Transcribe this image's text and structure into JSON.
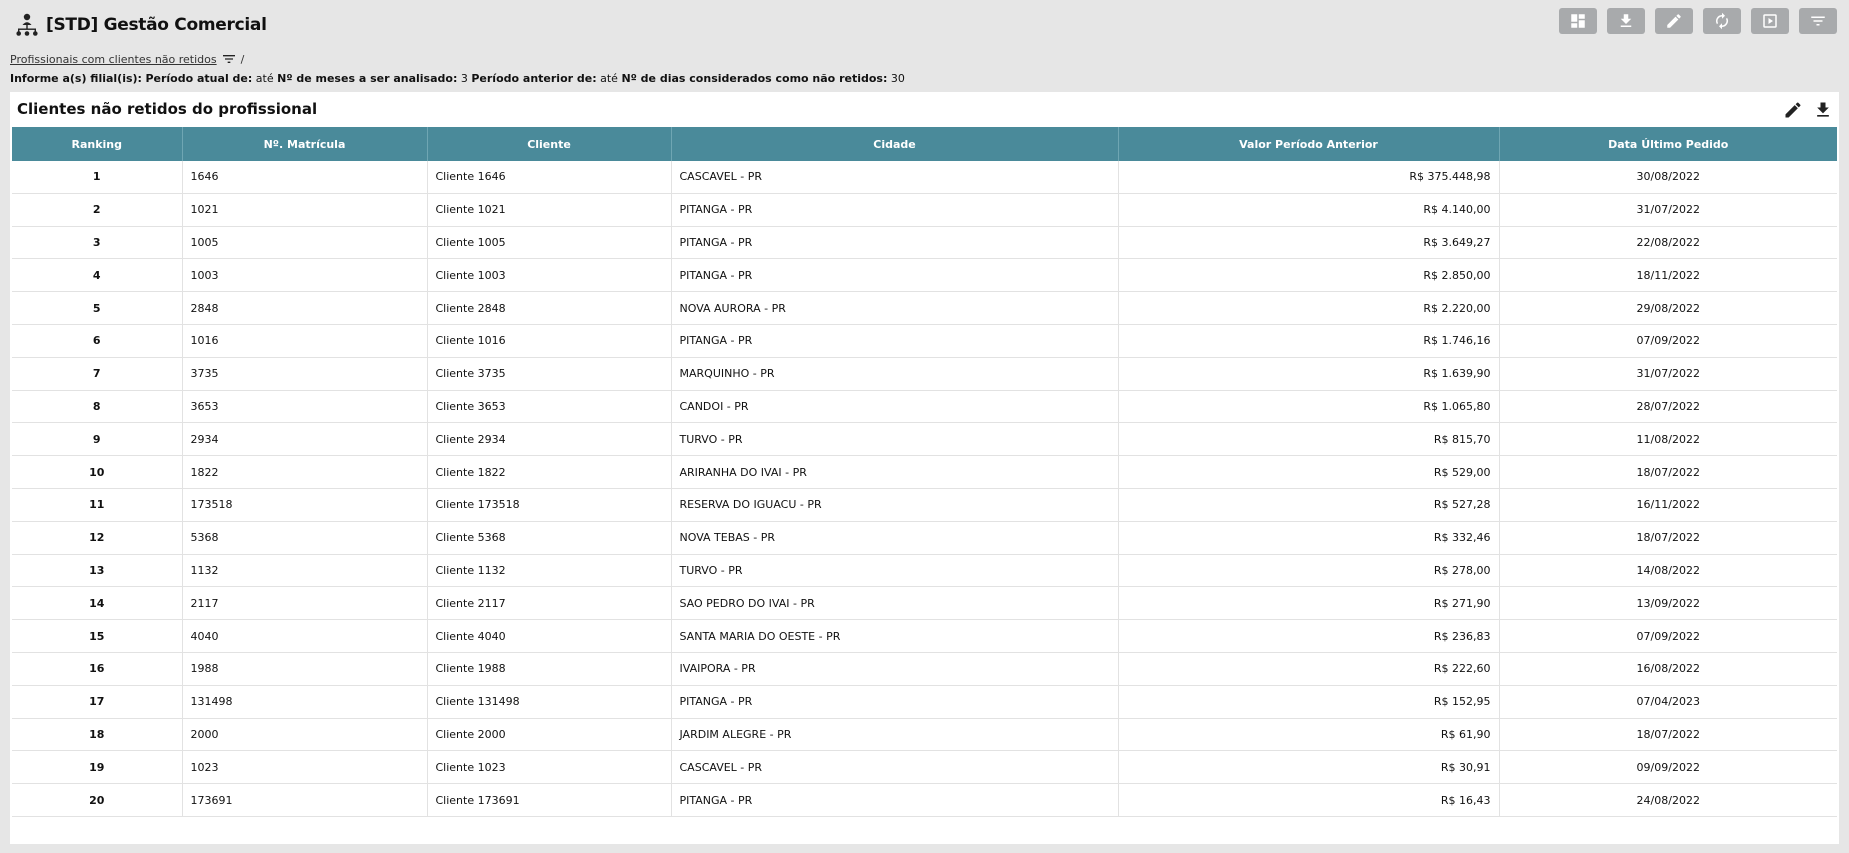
{
  "app": {
    "title": "[STD] Gestão Comercial",
    "logo_icon": "user-hierarchy-icon"
  },
  "toolbar": {
    "buttons": [
      {
        "icon": "dashboard-icon"
      },
      {
        "icon": "download-icon"
      },
      {
        "icon": "edit-icon"
      },
      {
        "icon": "refresh-icon"
      },
      {
        "icon": "play-icon"
      },
      {
        "icon": "filter-icon"
      }
    ],
    "color": "#a8aaac"
  },
  "breadcrumb": {
    "link": "Profissionais com clientes não retidos",
    "separator": "/"
  },
  "filters": {
    "filial_label": "Informe a(s) filial(is):",
    "periodo_atual_label": "Período atual de:",
    "periodo_atual_value": "até",
    "meses_label": "Nº de meses a ser analisado:",
    "meses_value": "3",
    "periodo_anterior_label": "Período anterior de:",
    "periodo_anterior_value": "até",
    "dias_label": "Nº de dias considerados como não retidos:",
    "dias_value": "30"
  },
  "panel": {
    "title": "Clientes não retidos do profissional"
  },
  "table": {
    "header_color": "#4a8a9a",
    "columns": [
      "Ranking",
      "Nº. Matrícula",
      "Cliente",
      "Cidade",
      "Valor Período Anterior",
      "Data Último Pedido"
    ],
    "rows": [
      [
        "1",
        "1646",
        "Cliente 1646",
        "CASCAVEL - PR",
        "R$ 375.448,98",
        "30/08/2022"
      ],
      [
        "2",
        "1021",
        "Cliente 1021",
        "PITANGA - PR",
        "R$ 4.140,00",
        "31/07/2022"
      ],
      [
        "3",
        "1005",
        "Cliente 1005",
        "PITANGA - PR",
        "R$ 3.649,27",
        "22/08/2022"
      ],
      [
        "4",
        "1003",
        "Cliente 1003",
        "PITANGA - PR",
        "R$ 2.850,00",
        "18/11/2022"
      ],
      [
        "5",
        "2848",
        "Cliente 2848",
        "NOVA AURORA - PR",
        "R$ 2.220,00",
        "29/08/2022"
      ],
      [
        "6",
        "1016",
        "Cliente 1016",
        "PITANGA - PR",
        "R$ 1.746,16",
        "07/09/2022"
      ],
      [
        "7",
        "3735",
        "Cliente 3735",
        "MARQUINHO - PR",
        "R$ 1.639,90",
        "31/07/2022"
      ],
      [
        "8",
        "3653",
        "Cliente 3653",
        "CANDOI - PR",
        "R$ 1.065,80",
        "28/07/2022"
      ],
      [
        "9",
        "2934",
        "Cliente 2934",
        "TURVO - PR",
        "R$ 815,70",
        "11/08/2022"
      ],
      [
        "10",
        "1822",
        "Cliente 1822",
        "ARIRANHA DO IVAI - PR",
        "R$ 529,00",
        "18/07/2022"
      ],
      [
        "11",
        "173518",
        "Cliente 173518",
        "RESERVA DO IGUACU - PR",
        "R$ 527,28",
        "16/11/2022"
      ],
      [
        "12",
        "5368",
        "Cliente 5368",
        "NOVA TEBAS - PR",
        "R$ 332,46",
        "18/07/2022"
      ],
      [
        "13",
        "1132",
        "Cliente 1132",
        "TURVO - PR",
        "R$ 278,00",
        "14/08/2022"
      ],
      [
        "14",
        "2117",
        "Cliente 2117",
        "SAO PEDRO DO IVAI - PR",
        "R$ 271,90",
        "13/09/2022"
      ],
      [
        "15",
        "4040",
        "Cliente 4040",
        "SANTA MARIA DO OESTE - PR",
        "R$ 236,83",
        "07/09/2022"
      ],
      [
        "16",
        "1988",
        "Cliente 1988",
        "IVAIPORA - PR",
        "R$ 222,60",
        "16/08/2022"
      ],
      [
        "17",
        "131498",
        "Cliente 131498",
        "PITANGA - PR",
        "R$ 152,95",
        "07/04/2023"
      ],
      [
        "18",
        "2000",
        "Cliente 2000",
        "JARDIM ALEGRE - PR",
        "R$ 61,90",
        "18/07/2022"
      ],
      [
        "19",
        "1023",
        "Cliente 1023",
        "CASCAVEL - PR",
        "R$ 30,91",
        "09/09/2022"
      ],
      [
        "20",
        "173691",
        "Cliente 173691",
        "PITANGA - PR",
        "R$ 16,43",
        "24/08/2022"
      ]
    ]
  }
}
